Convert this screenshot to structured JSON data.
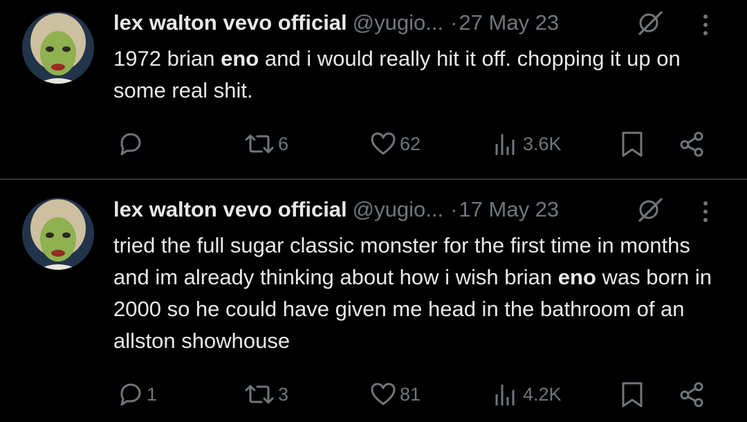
{
  "tweets": [
    {
      "display_name": "lex walton vevo official",
      "handle": "@yugio...",
      "separator": "·",
      "date": "27 May 23",
      "text_segments": [
        "1972 brian ",
        "eno",
        " and i would really hit it off. chopping it up on some real shit."
      ],
      "bold_segment_index": 1,
      "actions": {
        "replies": "",
        "retweets": "6",
        "likes": "62",
        "views": "3.6K"
      }
    },
    {
      "display_name": "lex walton vevo official",
      "handle": "@yugio...",
      "separator": "·",
      "date": "17 May 23",
      "text_segments": [
        "tried the full sugar classic monster for the first time in months and im already thinking about how i wish brian ",
        "eno",
        " was born in 2000 so he could have given me head in the bathroom of an allston showhouse"
      ],
      "bold_segment_index": 1,
      "actions": {
        "replies": "1",
        "retweets": "3",
        "likes": "81",
        "views": "4.2K"
      }
    }
  ],
  "colors": {
    "background": "#000000",
    "text": "#e7e9ea",
    "secondary": "#71767b",
    "divider": "#2f3336"
  },
  "icons": {
    "avatar": "profile-photo",
    "grok": "grok-slash-icon",
    "more": "more-vertical-icon",
    "reply": "reply-bubble-icon",
    "retweet": "retweet-icon",
    "like": "heart-icon",
    "views": "bar-chart-icon",
    "bookmark": "bookmark-icon",
    "share": "share-icon"
  }
}
